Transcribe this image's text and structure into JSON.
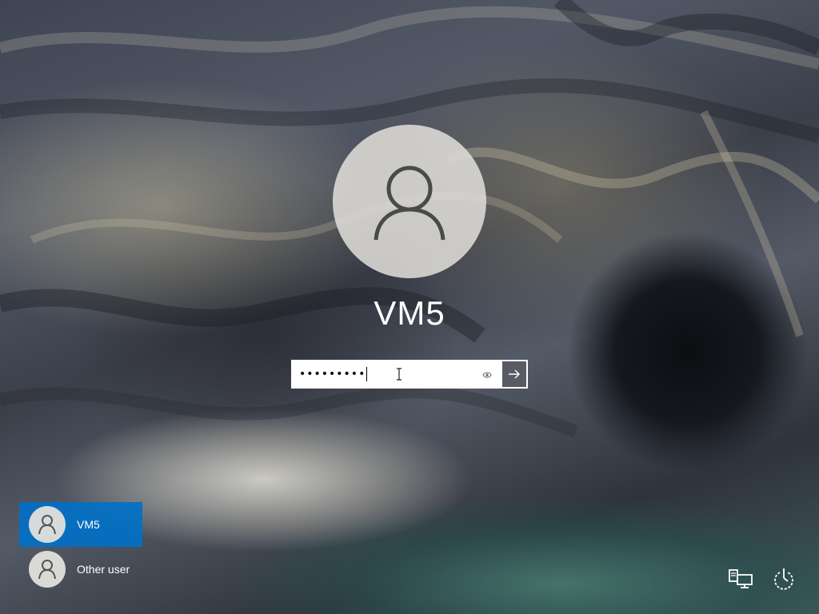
{
  "login": {
    "username": "VM5",
    "password_mask": "•••••••••"
  },
  "user_list": [
    {
      "name": "VM5",
      "selected": true
    },
    {
      "name": "Other user",
      "selected": false
    }
  ],
  "icons": {
    "avatar": "user-silhouette-icon",
    "reveal": "eye-icon",
    "submit": "arrow-right-icon",
    "network": "network-icon",
    "power": "power-icon"
  },
  "colors": {
    "selected_user": "#0070c8",
    "password_field": "#ffffff",
    "submit_button": "#5a5c64"
  }
}
